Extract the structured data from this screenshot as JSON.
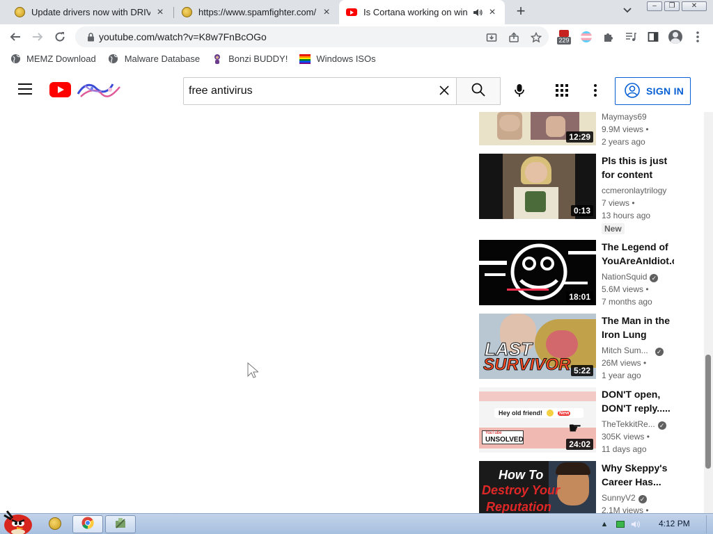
{
  "tabs": [
    {
      "title": "Update drivers now with DRIV",
      "favicon": "coin-icon",
      "active": false
    },
    {
      "title": "https://www.spamfighter.com/",
      "favicon": "coin-icon",
      "active": false
    },
    {
      "title": "Is Cortana working on win",
      "favicon": "youtube-icon",
      "active": true,
      "audio": true
    }
  ],
  "address_bar": {
    "url": "youtube.com/watch?v=K8w7FnBcOGo",
    "extension_badge": "229"
  },
  "bookmarks": [
    {
      "label": "MEMZ Download",
      "icon": "globe-icon"
    },
    {
      "label": "Malware Database",
      "icon": "globe-icon"
    },
    {
      "label": "Bonzi BUDDY!",
      "icon": "bonzi-icon"
    },
    {
      "label": "Windows ISOs",
      "icon": "rainbow-flag-icon"
    }
  ],
  "youtube": {
    "search_query": "free antivirus",
    "sign_in_label": "SIGN IN",
    "brand_color": "#ff0000",
    "link_color": "#065fd4"
  },
  "related_videos": [
    {
      "title": "",
      "channel": "Maymays69",
      "views": "9.9M views",
      "age": "2 years ago",
      "duration": "12:29",
      "verified": false,
      "badge": ""
    },
    {
      "title": "Pls this is just for content an...",
      "channel": "ccmeronlaytrilogy",
      "views": "7 views",
      "age": "13 hours ago",
      "duration": "0:13",
      "verified": false,
      "badge": "New"
    },
    {
      "title": "The Legend of YouAreAnIdiot.c",
      "channel": "NationSquid",
      "views": "5.6M views",
      "age": "7 months ago",
      "duration": "18:01",
      "verified": true,
      "badge": ""
    },
    {
      "title": "The Man in the Iron Lung",
      "channel": "Mitch Sum...",
      "views": "26M views",
      "age": "1 year ago",
      "duration": "5:22",
      "verified": true,
      "badge": ""
    },
    {
      "title": "DON'T open, DON'T reply.....",
      "channel": "TheTekkitRe...",
      "views": "305K views",
      "age": "11 days ago",
      "duration": "24:02",
      "verified": true,
      "badge": ""
    },
    {
      "title": "Why Skeppy's Career Has...",
      "channel": "SunnyV2",
      "views": "2.1M views",
      "age": "",
      "duration": "",
      "verified": true,
      "badge": ""
    }
  ],
  "thumb_text": {
    "last": "LAST",
    "survivor": "SURVIVOR",
    "hey": "Hey old friend!",
    "new_tag": "New",
    "yt_small": "YouTube",
    "unsolved": "UNSOLVED",
    "how_to": "How To",
    "destroy": "Destroy Your",
    "reputation": "Reputation"
  },
  "taskbar": {
    "time": "4:12 PM"
  }
}
